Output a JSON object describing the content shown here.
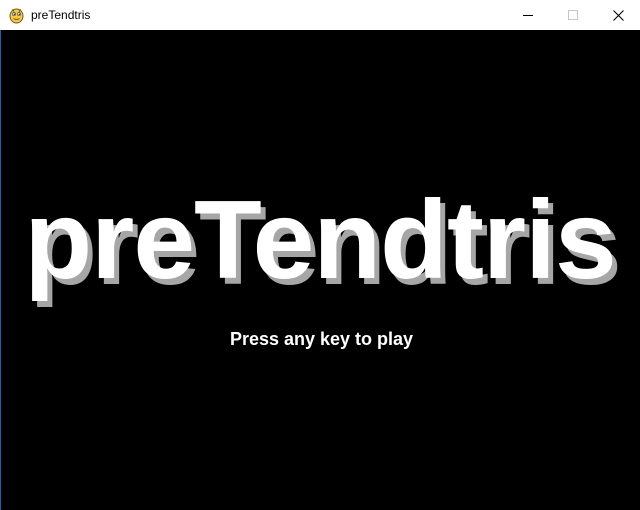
{
  "window": {
    "title": "preTendtris",
    "app_icon": "python-snake-icon",
    "controls": {
      "minimize_icon": "minimize-icon",
      "maximize_icon": "maximize-icon",
      "close_icon": "close-icon"
    }
  },
  "game": {
    "title": "preTendtris",
    "prompt": "Press any key to play",
    "colors": {
      "background": "#000000",
      "title_text": "#ffffff",
      "title_shadow": "#a6a6a6",
      "prompt_text": "#ffffff"
    }
  }
}
